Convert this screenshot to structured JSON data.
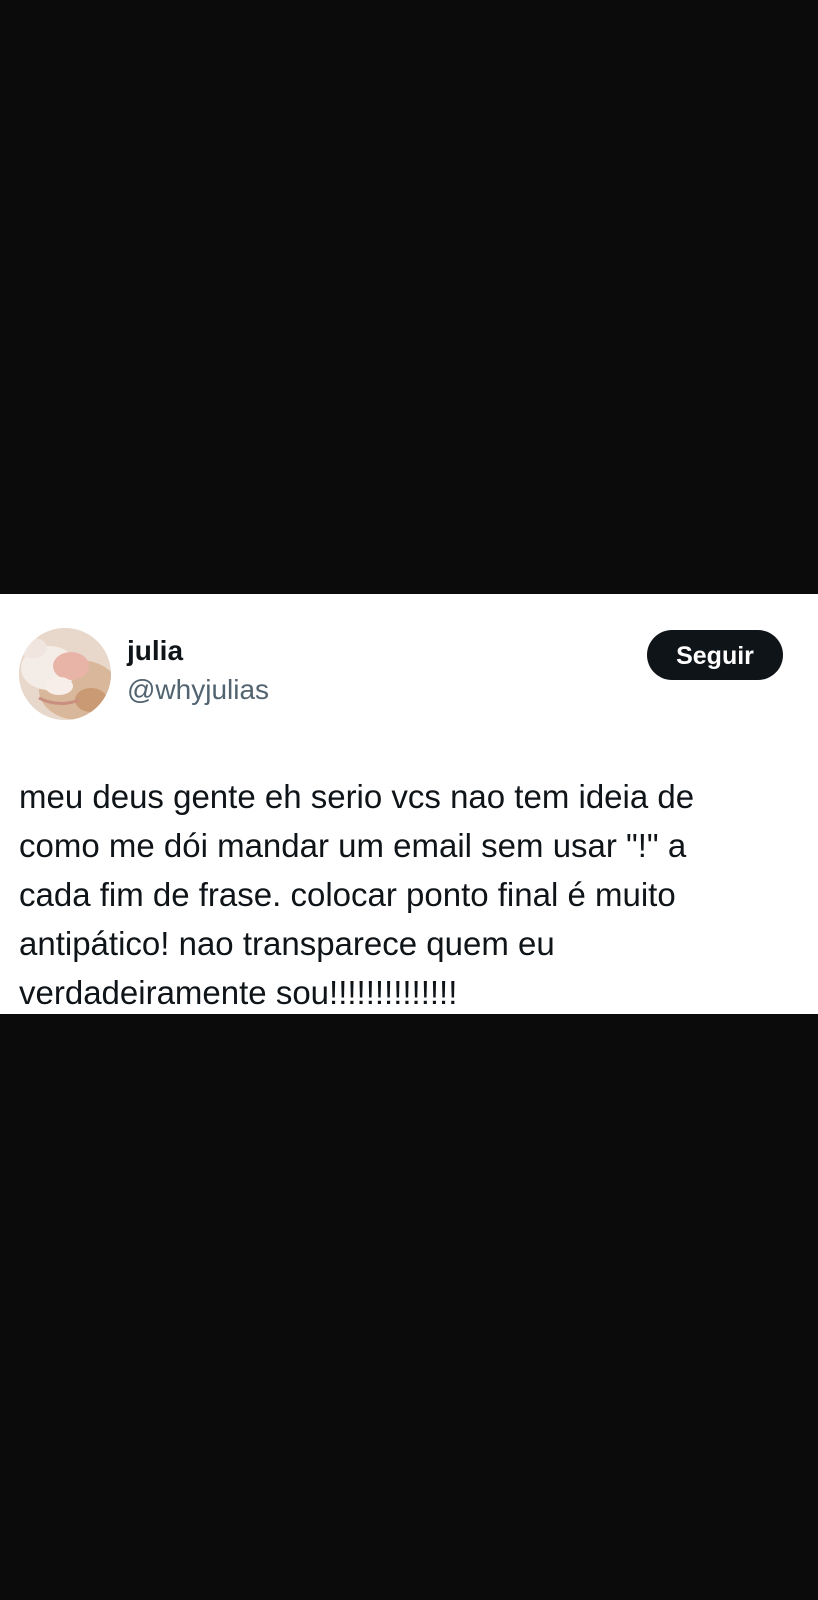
{
  "tweet": {
    "display_name": "julia",
    "handle": "@whyjulias",
    "follow_label": "Seguir",
    "text": "meu deus gente eh serio vcs nao tem ideia de\ncomo me dói mandar um email sem usar \"!\" a\ncada fim de frase. colocar ponto final é muito\nantipático! nao transparece quem eu\nverdadeiramente sou!!!!!!!!!!!!!!"
  },
  "icons": {
    "avatar": "profile-photo-cat"
  },
  "colors": {
    "background": "#0b0b0c",
    "card": "#ffffff",
    "text": "#0f1419",
    "handle": "#536471",
    "button": "#0f1419"
  }
}
